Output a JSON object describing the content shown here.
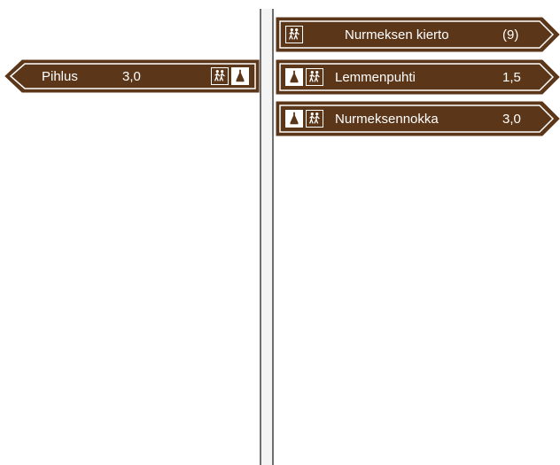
{
  "colors": {
    "sign_brown": "#5b3619",
    "border_white": "#ffffff",
    "pole": "#f4f4f4",
    "pole_edge": "#6f6f6f"
  },
  "left_sign": {
    "name": "Pihlus",
    "distance": "3,0",
    "icons": [
      "hiking-icon",
      "boot-icon"
    ],
    "direction": "left"
  },
  "right_signs": [
    {
      "name": "Nurmeksen kierto",
      "distance": "(9)",
      "icons": [
        "hiking-icon"
      ],
      "direction": "right"
    },
    {
      "name": "Lemmenpuhti",
      "distance": "1,5",
      "icons": [
        "boot-icon",
        "hiking-icon"
      ],
      "direction": "right"
    },
    {
      "name": "Nurmeksennokka",
      "distance": "3,0",
      "icons": [
        "boot-icon",
        "hiking-icon"
      ],
      "direction": "right"
    }
  ]
}
